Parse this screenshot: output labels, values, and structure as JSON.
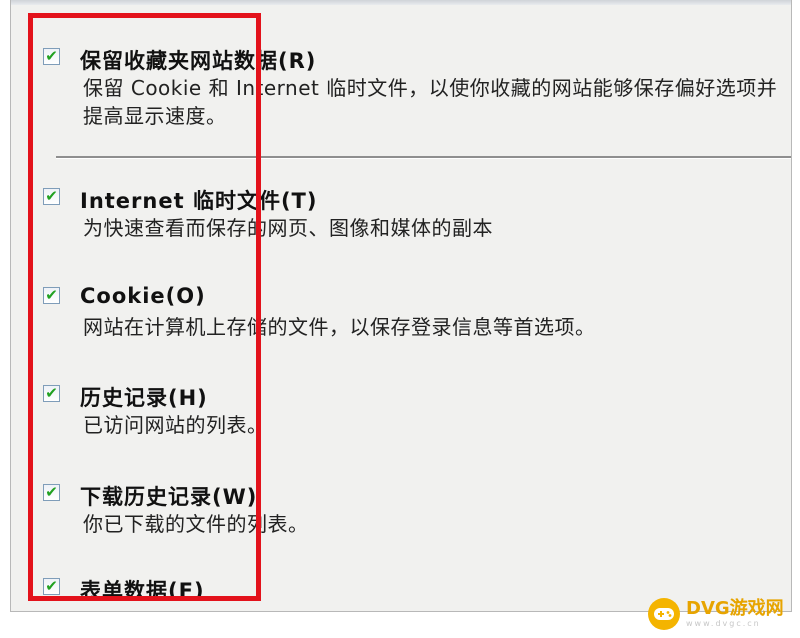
{
  "items": [
    {
      "checked": true,
      "check_glyph": "✔",
      "title": "保留收藏夹网站数据(R)",
      "desc": "保留 Cookie 和 Internet 临时文件，以使你收藏的网站能够保存偏好选项并提高显示速度。"
    },
    {
      "checked": true,
      "check_glyph": "✔",
      "title": "Internet 临时文件(T)",
      "desc": "为快速查看而保存的网页、图像和媒体的副本"
    },
    {
      "checked": true,
      "check_glyph": "✔",
      "title": "Cookie(O)",
      "desc": "网站在计算机上存储的文件，以保存登录信息等首选项。"
    },
    {
      "checked": true,
      "check_glyph": "✔",
      "title": "历史记录(H)",
      "desc": "已访问网站的列表。"
    },
    {
      "checked": true,
      "check_glyph": "✔",
      "title": "下载历史记录(W)",
      "desc": "你已下载的文件的列表。"
    },
    {
      "checked": true,
      "check_glyph": "✔",
      "title": "表单数据(F)",
      "desc": ""
    }
  ],
  "highlight": {
    "color": "#e3121b"
  },
  "watermark": {
    "name": "DVG游戏网",
    "url": "www.dvgc.cn",
    "icon": "gamepad-icon"
  }
}
